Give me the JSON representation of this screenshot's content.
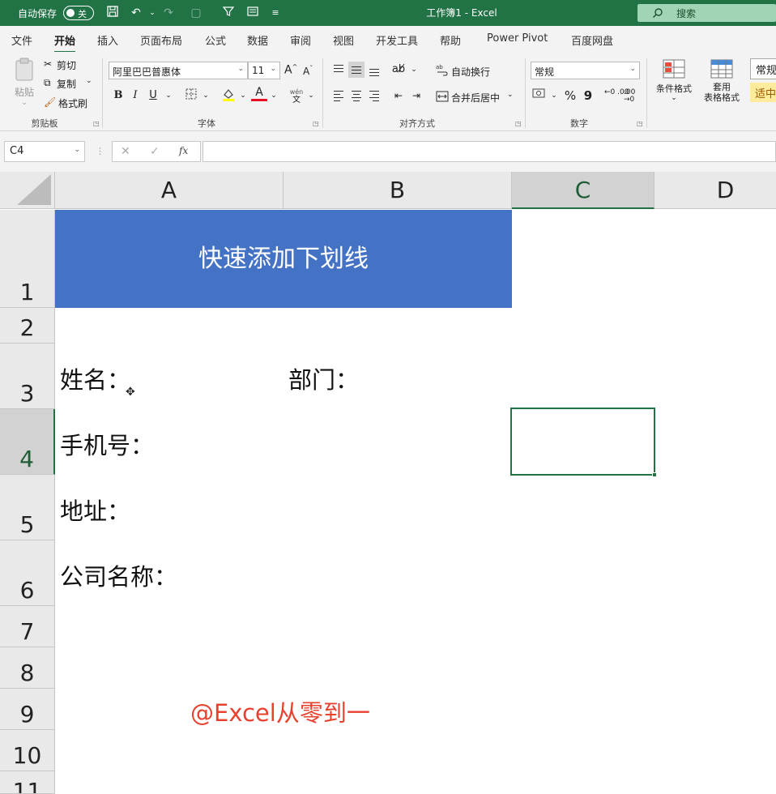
{
  "titlebar": {
    "autosave_label": "自动保存",
    "autosave_state": "关",
    "doc_title": "工作簿1  -  Excel",
    "search_label": "搜索"
  },
  "tabs": [
    "文件",
    "开始",
    "插入",
    "页面布局",
    "公式",
    "数据",
    "审阅",
    "视图",
    "开发工具",
    "帮助",
    "Power Pivot",
    "百度网盘"
  ],
  "active_tab": "开始",
  "ribbon": {
    "clipboard": {
      "paste": "粘贴",
      "cut": "剪切",
      "copy": "复制",
      "format_painter": "格式刷",
      "group": "剪贴板"
    },
    "font": {
      "font_name": "阿里巴巴普惠体",
      "font_size": "11",
      "bold": "B",
      "italic": "I",
      "underline": "U",
      "font_color_glyph": "A",
      "wen": "wén",
      "wen_char": "文",
      "grow": "A",
      "shrink": "A",
      "group": "字体"
    },
    "alignment": {
      "wrap_text": "自动换行",
      "merge_center": "合并后居中",
      "group": "对齐方式"
    },
    "number": {
      "format": "常规",
      "percent": "%",
      "comma": "9",
      "inc_dec": "←0 .00",
      "dec_dec": ".00 →0",
      "group": "数字"
    },
    "styles": {
      "conditional_format": "条件格式",
      "table_format_line1": "套用",
      "table_format_line2": "表格格式",
      "style_normal": "常规",
      "style_neutral": "适中"
    }
  },
  "formula_bar": {
    "name_box": "C4",
    "fx": "fx",
    "formula": ""
  },
  "columns": [
    "A",
    "B",
    "C",
    "D"
  ],
  "selected_column": "C",
  "rows": [
    "1",
    "2",
    "3",
    "4",
    "5",
    "6",
    "7",
    "8",
    "9",
    "10",
    "11"
  ],
  "selected_row": "4",
  "cells": {
    "title": "快速添加下划线",
    "name_label": "姓名：",
    "dept_label": "部门：",
    "phone_label": "手机号：",
    "address_label": "地址：",
    "company_label": "公司名称："
  },
  "watermark": "@Excel从零到一",
  "colors": {
    "title_bar": "#217346",
    "header_fill": "#4472c4",
    "watermark": "#e8412f",
    "selection": "#217346"
  }
}
